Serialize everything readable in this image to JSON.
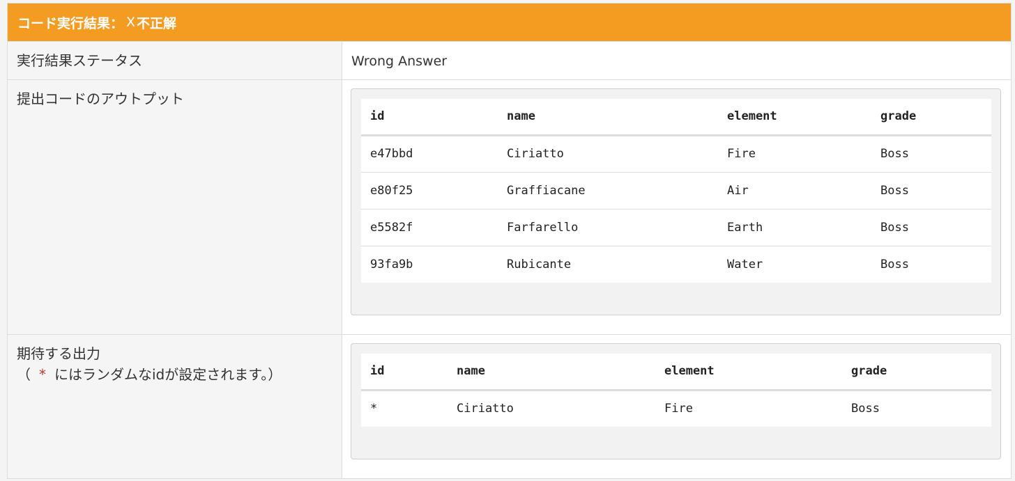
{
  "header": {
    "title": "コード実行結果：",
    "mark": "X",
    "verdict": "不正解"
  },
  "status": {
    "label": "実行結果ステータス",
    "value": "Wrong Answer"
  },
  "output": {
    "label": "提出コードのアウトプット",
    "columns": [
      "id",
      "name",
      "element",
      "grade"
    ],
    "rows": [
      [
        "e47bbd",
        "Ciriatto",
        "Fire",
        "Boss"
      ],
      [
        "e80f25",
        "Graffiacane",
        "Air",
        "Boss"
      ],
      [
        "e5582f",
        "Farfarello",
        "Earth",
        "Boss"
      ],
      [
        "93fa9b",
        "Rubicante",
        "Water",
        "Boss"
      ]
    ]
  },
  "expected": {
    "label": "期待する出力",
    "note_open": "（",
    "note_asterisk": "*",
    "note_text": "にはランダムなidが設定されます。）",
    "columns": [
      "id",
      "name",
      "element",
      "grade"
    ],
    "rows": [
      [
        "*",
        "Ciriatto",
        "Fire",
        "Boss"
      ]
    ]
  },
  "colors": {
    "header_bg": "#f39c21",
    "asterisk": "#c0392b"
  }
}
